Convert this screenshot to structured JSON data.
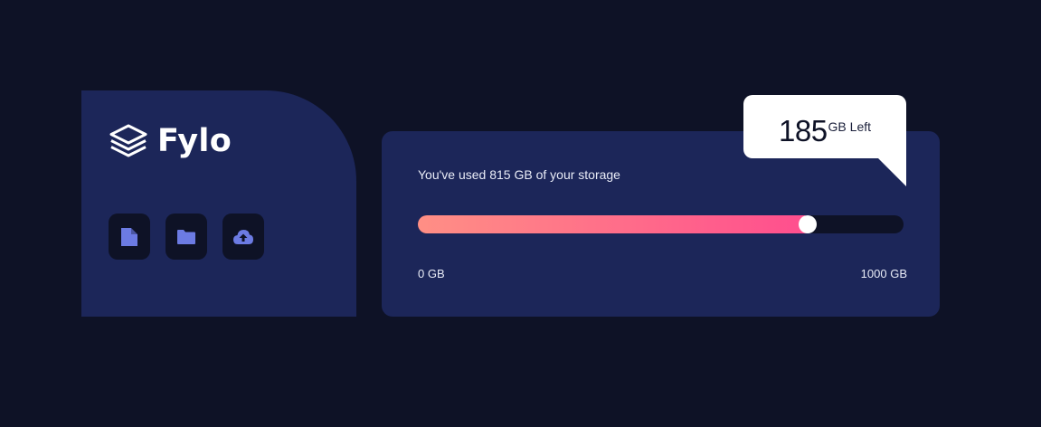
{
  "brand": {
    "name": "Fylo",
    "logo_icon": "layers-stack-icon"
  },
  "actions": [
    {
      "icon": "document-icon"
    },
    {
      "icon": "folder-icon"
    },
    {
      "icon": "cloud-upload-icon"
    }
  ],
  "storage": {
    "usage_text": "You've used 815 GB of your storage",
    "used": 815,
    "total": 1000,
    "scale_min": "0 GB",
    "scale_max": "1000 GB",
    "remaining_value": "185",
    "remaining_unit": "GB Left"
  },
  "colors": {
    "background": "#0e1226",
    "card": "#1c2659",
    "gradient_start": "#ff8f85",
    "gradient_end": "#ff4d8e",
    "icon": "#6c7be3"
  }
}
